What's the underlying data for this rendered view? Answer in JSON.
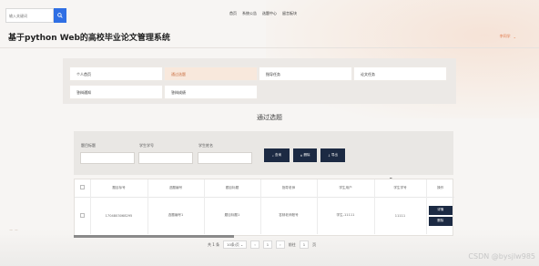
{
  "header": {
    "search": {
      "placeholder": "输入关键词",
      "value": ""
    },
    "nav": [
      "首页",
      "系统公告",
      "选题中心",
      "留言板块"
    ],
    "site_title": "基于python Web的高校毕业论文管理系统",
    "user": "李同学"
  },
  "menu": {
    "items": [
      {
        "label": "个人首页",
        "active": false
      },
      {
        "label": "通过选题",
        "active": true
      },
      {
        "label": "指导任务",
        "active": false
      },
      {
        "label": "论文任务",
        "active": false
      },
      {
        "label": "答辩通知",
        "active": false
      },
      {
        "label": "答辩成绩",
        "active": false
      }
    ]
  },
  "section": {
    "title": "通过选题"
  },
  "filters": {
    "fields": [
      {
        "label": "题目标题",
        "value": ""
      },
      {
        "label": "学生学号",
        "value": ""
      },
      {
        "label": "学生姓名",
        "value": ""
      }
    ],
    "buttons": [
      "查询",
      "删除",
      "导出"
    ]
  },
  "table": {
    "columns": [
      "题目标号",
      "选题编号",
      "题目标题",
      "指导老师",
      "学生用户",
      "学生学号",
      "操作"
    ],
    "rows": [
      {
        "cells": [
          "1704803068295",
          "选题编号1",
          "题目标题1",
          "答辩老师账号",
          "学生-11111",
          "11111"
        ],
        "actions": [
          "详情",
          "删除"
        ]
      }
    ]
  },
  "pagination": {
    "total": "共 1 条",
    "page_size": "10条/页",
    "current": "1",
    "goto_label": "前往",
    "goto_value": "1",
    "goto_suffix": "页"
  },
  "watermark": "CSDN @bysjlw985",
  "colors": {
    "accent": "#c96f42",
    "primary_dark": "#1c2a43",
    "search_blue": "#2f6fe4"
  }
}
